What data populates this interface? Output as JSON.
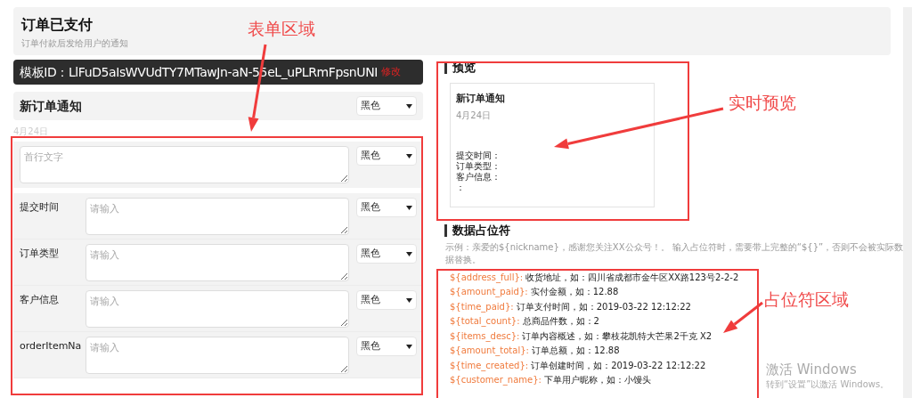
{
  "header": {
    "title": "订单已支付",
    "subtitle": "订单付款后发给用户的通知"
  },
  "template_id": {
    "label": "模板ID：LlFuD5aIsWVUdTY7MTawJn-aN-55eL_uPLRmFpsnUNI",
    "edit_link": "修改"
  },
  "form": {
    "title_field": {
      "value": "新订单通知",
      "select": "黑色"
    },
    "date": "4月24日",
    "first_line": {
      "placeholder": "首行文字",
      "select": "黑色"
    },
    "fields": [
      {
        "label": "提交时间",
        "placeholder": "请输入",
        "select": "黑色"
      },
      {
        "label": "订单类型",
        "placeholder": "请输入",
        "select": "黑色"
      },
      {
        "label": "客户信息",
        "placeholder": "请输入",
        "select": "黑色"
      },
      {
        "label": "orderItemNa",
        "placeholder": "请输入",
        "select": "黑色"
      }
    ]
  },
  "preview": {
    "heading": "预览",
    "title": "新订单通知",
    "date": "4月24日",
    "lines": [
      "提交时间：",
      "订单类型：",
      "客户信息：",
      "："
    ]
  },
  "placeholders": {
    "heading": "数据占位符",
    "example": "示例：亲爱的${nickname}，感谢您关注XX公众号！。 输入占位符时，需要带上完整的“${}”，否则不会被实际数据替换。",
    "items": [
      {
        "key": "${address_full}:",
        "description": "收货地址，如：四川省成都市金牛区XX路123号2-2-2"
      },
      {
        "key": "${amount_paid}:",
        "description": "实付金额，如：12.88"
      },
      {
        "key": "${time_paid}:",
        "description": "订单支付时间，如：2019-03-22 12:12:22"
      },
      {
        "key": "${total_count}:",
        "description": "总商品件数，如：2"
      },
      {
        "key": "${items_desc}:",
        "description": "订单内容概述，如：攀枝花凯特大芒果2千克 X2"
      },
      {
        "key": "${amount_total}:",
        "description": "订单总额，如：12.88"
      },
      {
        "key": "${time_created}:",
        "description": "订单创建时间，如：2019-03-22 12:12:22"
      },
      {
        "key": "${customer_name}:",
        "description": "下单用户昵称，如：小馒头"
      }
    ]
  },
  "annotations": [
    {
      "text": "表单区域"
    },
    {
      "text": "实时预览"
    },
    {
      "text": "占位符区域"
    }
  ],
  "os_notice": {
    "title": "激活 Windows",
    "subtitle": "转到“设置”以激活 Windows。"
  }
}
